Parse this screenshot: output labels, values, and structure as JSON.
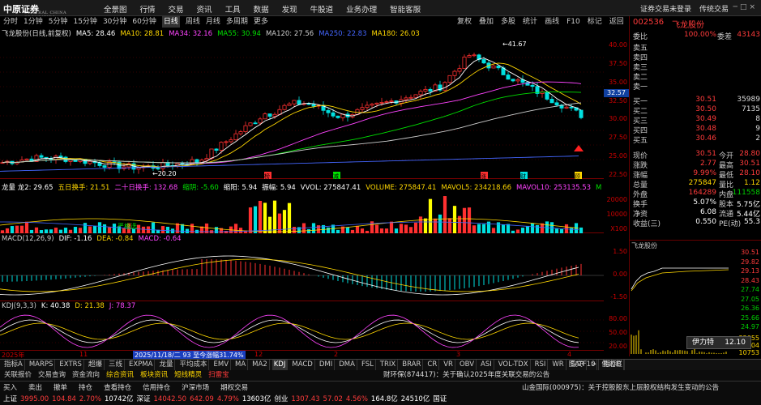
{
  "app": {
    "logo": "中原证券",
    "logo_sub": "CENTRAL CHINA SECURITIES",
    "menu": [
      "全景图",
      "行情",
      "交易",
      "资讯",
      "工具",
      "数据",
      "发现",
      "牛股道",
      "业务办理",
      "智能客服"
    ],
    "right_links": [
      "证券交易未登录",
      "传统交易"
    ]
  },
  "timeframes": [
    "分时",
    "1分钟",
    "5分钟",
    "15分钟",
    "30分钟",
    "60分钟",
    "日线",
    "周线",
    "月线",
    "多周期",
    "更多"
  ],
  "active_timeframe": "日线",
  "toolbar": [
    "复权",
    "叠加",
    "多股",
    "统计",
    "画线",
    "F10",
    "标记",
    "返回"
  ],
  "main_legend": {
    "title": "飞龙股份(日线,前复权)",
    "items": [
      {
        "label": "MA5: 28.46",
        "color": "#ffffff"
      },
      {
        "label": "MA10: 28.81",
        "color": "#ffd700"
      },
      {
        "label": "MA34: 32.16",
        "color": "#ff44ff"
      },
      {
        "label": "MA55: 30.94",
        "color": "#00e000"
      },
      {
        "label": "MA120: 27.56",
        "color": "#cccccc"
      },
      {
        "label": "MA250: 22.83",
        "color": "#4466ff"
      },
      {
        "label": "MA180: 26.03",
        "color": "#ffd700"
      }
    ]
  },
  "main_axis": [
    "40.00",
    "37.50",
    "35.00",
    "32.50",
    "30.00",
    "27.50",
    "25.00",
    "22.50"
  ],
  "main_annotations": {
    "high": "41.67",
    "low": "20.20",
    "current_price": "32.57"
  },
  "signals": [
    "榜",
    "减",
    "涨",
    "财",
    "顾"
  ],
  "vol_legend": {
    "items": [
      {
        "label": "龙量 龙2: 29.65",
        "color": "#ffffff"
      },
      {
        "label": "五日换手: 21.51",
        "color": "#ffd700"
      },
      {
        "label": "二十日换手: 132.68",
        "color": "#ff44ff"
      },
      {
        "label": "缩阴: -5.60",
        "color": "#00e000"
      },
      {
        "label": "缩阳: 5.94",
        "color": "#ffffff"
      },
      {
        "label": "振幅: 5.94",
        "color": "#ffffff"
      },
      {
        "label": "VVOL: 275847.41",
        "color": "#ffffff"
      },
      {
        "label": "VOLUME: 275847.41",
        "color": "#ffd700"
      },
      {
        "label": "MAVOL5: 234218.66",
        "color": "#ffd700"
      },
      {
        "label": "MAVOL10: 253135.53",
        "color": "#ff44ff"
      },
      {
        "label": "M",
        "color": "#00e000"
      }
    ]
  },
  "vol_axis": [
    "20000",
    "10000",
    "X100"
  ],
  "vol_tag": "严格选",
  "macd_legend": {
    "items": [
      {
        "label": "MACD(12,26,9)",
        "color": "#cccccc"
      },
      {
        "label": "DIF: -1.16",
        "color": "#ffffff"
      },
      {
        "label": "DEA: -0.84",
        "color": "#ffd700"
      },
      {
        "label": "MACD: -0.64",
        "color": "#ff44ff"
      }
    ]
  },
  "macd_axis": [
    "1.50",
    "0.00",
    "-1.50"
  ],
  "kdj_legend": {
    "items": [
      {
        "label": "KDJ(9,3,3)",
        "color": "#cccccc"
      },
      {
        "label": "K: 40.38",
        "color": "#ffffff"
      },
      {
        "label": "D: 21.38",
        "color": "#ffd700"
      },
      {
        "label": "J: 78.37",
        "color": "#ff44ff"
      }
    ]
  },
  "kdj_axis": [
    "80.00",
    "50.00",
    "20.00"
  ],
  "timeline": {
    "year": "2025年",
    "marks": [
      "11",
      "12",
      "2",
      "3",
      "4"
    ],
    "highlight": "2025/11/18/二 93 至今涨幅31.74%"
  },
  "quote": {
    "code": "002536",
    "name": "飞龙股份",
    "ratio_label": "委比",
    "ratio_value": "100.00%",
    "diff_label": "委差",
    "diff_value": "43143",
    "sells": [
      {
        "label": "卖五",
        "price": "",
        "vol": ""
      },
      {
        "label": "卖四",
        "price": "",
        "vol": ""
      },
      {
        "label": "卖三",
        "price": "",
        "vol": ""
      },
      {
        "label": "卖二",
        "price": "",
        "vol": ""
      },
      {
        "label": "卖一",
        "price": "",
        "vol": ""
      }
    ],
    "buys": [
      {
        "label": "买一",
        "price": "30.51",
        "vol": "35989"
      },
      {
        "label": "买二",
        "price": "30.50",
        "vol": "7135"
      },
      {
        "label": "买三",
        "price": "30.49",
        "vol": "8"
      },
      {
        "label": "买四",
        "price": "30.48",
        "vol": "9"
      },
      {
        "label": "买五",
        "price": "30.46",
        "vol": "2"
      }
    ],
    "stats": [
      {
        "l1": "现价",
        "v1": "30.51",
        "l2": "今开",
        "v2": "28.80",
        "c1": "red",
        "c2": "red"
      },
      {
        "l1": "涨跌",
        "v1": "2.77",
        "l2": "最高",
        "v2": "30.51",
        "c1": "red",
        "c2": "red"
      },
      {
        "l1": "涨幅",
        "v1": "9.99%",
        "l2": "最低",
        "v2": "28.10",
        "c1": "red",
        "c2": "red"
      },
      {
        "l1": "总量",
        "v1": "275847",
        "l2": "量比",
        "v2": "1.12",
        "c1": "yel",
        "c2": "yel"
      },
      {
        "l1": "外盘",
        "v1": "164289",
        "l2": "内盘",
        "v2": "111558",
        "c1": "red",
        "c2": "grn"
      },
      {
        "l1": "换手",
        "v1": "5.07%",
        "l2": "股本",
        "v2": "5.75亿",
        "c1": "wht",
        "c2": "wht"
      },
      {
        "l1": "净资",
        "v1": "6.08",
        "l2": "流通",
        "v2": "5.44亿",
        "c1": "wht",
        "c2": "wht"
      },
      {
        "l1": "收益(三)",
        "v1": "0.550",
        "l2": "PE(动)",
        "v2": "55.3",
        "c1": "wht",
        "c2": "wht"
      }
    ],
    "mini_title": "飞龙股份",
    "mini_axis": [
      "30.51",
      "29.82",
      "29.13",
      "28.43",
      "27.74",
      "27.05",
      "26.36",
      "25.66",
      "24.97"
    ],
    "mini_vol_axis": [
      "32055",
      "21404",
      "10753"
    ],
    "tooltip_name": "伊力特",
    "tooltip_price": "12.10"
  },
  "bottom_tabs": [
    "指标A",
    "MARPS",
    "EXTRS",
    "超爆",
    "三线",
    "EXPMA",
    "龙量",
    "平均成本",
    "EMV",
    "MA",
    "MA2",
    "KDJ",
    "MACD",
    "DMI",
    "DMA",
    "FSL",
    "TRIX",
    "BRAR",
    "CR",
    "VR",
    "OBV",
    "ASI",
    "VOL-TDX",
    "RSI",
    "WR",
    "SAR",
    ">",
    "指标B"
  ],
  "right_tabs": [
    "图文F10",
    "侧边栏"
  ],
  "nav": [
    "关联报价",
    "交易查询",
    "资金流向",
    "综合资讯",
    "板块资讯",
    "短线精灵",
    "扫雷宝"
  ],
  "news": "财环保(874417)：关于确认2025年度关联交易的公告",
  "news2": "山金国际(000975)：关于控股股东上层股权结构发生变动的公告",
  "status_buttons": [
    "买入",
    "卖出",
    "撤单",
    "持仓",
    "查看持仓",
    "信用持仓",
    "沪深市场",
    "期权交易"
  ],
  "indices": [
    {
      "name": "上证",
      "value": "3995.00",
      "chg": "104.84",
      "pct": "2.70%",
      "amt": "10742亿"
    },
    {
      "name": "深证",
      "value": "14042.50",
      "chg": "642.09",
      "pct": "4.79%",
      "amt": "13603亿"
    },
    {
      "name": "创业",
      "value": "1307.43",
      "chg": "57.02",
      "pct": "4.56%",
      "amt": "164.8亿"
    }
  ],
  "status_tail": [
    "24510亿",
    "国证"
  ]
}
